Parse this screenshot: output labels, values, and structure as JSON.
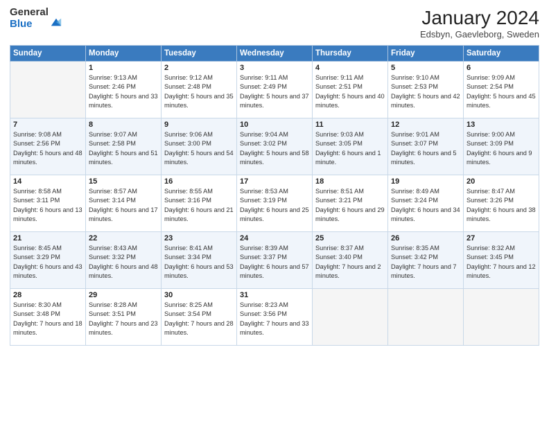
{
  "header": {
    "logo_general": "General",
    "logo_blue": "Blue",
    "month_title": "January 2024",
    "subtitle": "Edsbyn, Gaevleborg, Sweden"
  },
  "days_of_week": [
    "Sunday",
    "Monday",
    "Tuesday",
    "Wednesday",
    "Thursday",
    "Friday",
    "Saturday"
  ],
  "weeks": [
    [
      {
        "day": "",
        "empty": true
      },
      {
        "day": "1",
        "sunrise": "9:13 AM",
        "sunset": "2:46 PM",
        "daylight": "5 hours and 33 minutes."
      },
      {
        "day": "2",
        "sunrise": "9:12 AM",
        "sunset": "2:48 PM",
        "daylight": "5 hours and 35 minutes."
      },
      {
        "day": "3",
        "sunrise": "9:11 AM",
        "sunset": "2:49 PM",
        "daylight": "5 hours and 37 minutes."
      },
      {
        "day": "4",
        "sunrise": "9:11 AM",
        "sunset": "2:51 PM",
        "daylight": "5 hours and 40 minutes."
      },
      {
        "day": "5",
        "sunrise": "9:10 AM",
        "sunset": "2:53 PM",
        "daylight": "5 hours and 42 minutes."
      },
      {
        "day": "6",
        "sunrise": "9:09 AM",
        "sunset": "2:54 PM",
        "daylight": "5 hours and 45 minutes."
      }
    ],
    [
      {
        "day": "7",
        "sunrise": "9:08 AM",
        "sunset": "2:56 PM",
        "daylight": "5 hours and 48 minutes."
      },
      {
        "day": "8",
        "sunrise": "9:07 AM",
        "sunset": "2:58 PM",
        "daylight": "5 hours and 51 minutes."
      },
      {
        "day": "9",
        "sunrise": "9:06 AM",
        "sunset": "3:00 PM",
        "daylight": "5 hours and 54 minutes."
      },
      {
        "day": "10",
        "sunrise": "9:04 AM",
        "sunset": "3:02 PM",
        "daylight": "5 hours and 58 minutes."
      },
      {
        "day": "11",
        "sunrise": "9:03 AM",
        "sunset": "3:05 PM",
        "daylight": "6 hours and 1 minute."
      },
      {
        "day": "12",
        "sunrise": "9:01 AM",
        "sunset": "3:07 PM",
        "daylight": "6 hours and 5 minutes."
      },
      {
        "day": "13",
        "sunrise": "9:00 AM",
        "sunset": "3:09 PM",
        "daylight": "6 hours and 9 minutes."
      }
    ],
    [
      {
        "day": "14",
        "sunrise": "8:58 AM",
        "sunset": "3:11 PM",
        "daylight": "6 hours and 13 minutes."
      },
      {
        "day": "15",
        "sunrise": "8:57 AM",
        "sunset": "3:14 PM",
        "daylight": "6 hours and 17 minutes."
      },
      {
        "day": "16",
        "sunrise": "8:55 AM",
        "sunset": "3:16 PM",
        "daylight": "6 hours and 21 minutes."
      },
      {
        "day": "17",
        "sunrise": "8:53 AM",
        "sunset": "3:19 PM",
        "daylight": "6 hours and 25 minutes."
      },
      {
        "day": "18",
        "sunrise": "8:51 AM",
        "sunset": "3:21 PM",
        "daylight": "6 hours and 29 minutes."
      },
      {
        "day": "19",
        "sunrise": "8:49 AM",
        "sunset": "3:24 PM",
        "daylight": "6 hours and 34 minutes."
      },
      {
        "day": "20",
        "sunrise": "8:47 AM",
        "sunset": "3:26 PM",
        "daylight": "6 hours and 38 minutes."
      }
    ],
    [
      {
        "day": "21",
        "sunrise": "8:45 AM",
        "sunset": "3:29 PM",
        "daylight": "6 hours and 43 minutes."
      },
      {
        "day": "22",
        "sunrise": "8:43 AM",
        "sunset": "3:32 PM",
        "daylight": "6 hours and 48 minutes."
      },
      {
        "day": "23",
        "sunrise": "8:41 AM",
        "sunset": "3:34 PM",
        "daylight": "6 hours and 53 minutes."
      },
      {
        "day": "24",
        "sunrise": "8:39 AM",
        "sunset": "3:37 PM",
        "daylight": "6 hours and 57 minutes."
      },
      {
        "day": "25",
        "sunrise": "8:37 AM",
        "sunset": "3:40 PM",
        "daylight": "7 hours and 2 minutes."
      },
      {
        "day": "26",
        "sunrise": "8:35 AM",
        "sunset": "3:42 PM",
        "daylight": "7 hours and 7 minutes."
      },
      {
        "day": "27",
        "sunrise": "8:32 AM",
        "sunset": "3:45 PM",
        "daylight": "7 hours and 12 minutes."
      }
    ],
    [
      {
        "day": "28",
        "sunrise": "8:30 AM",
        "sunset": "3:48 PM",
        "daylight": "7 hours and 18 minutes."
      },
      {
        "day": "29",
        "sunrise": "8:28 AM",
        "sunset": "3:51 PM",
        "daylight": "7 hours and 23 minutes."
      },
      {
        "day": "30",
        "sunrise": "8:25 AM",
        "sunset": "3:54 PM",
        "daylight": "7 hours and 28 minutes."
      },
      {
        "day": "31",
        "sunrise": "8:23 AM",
        "sunset": "3:56 PM",
        "daylight": "7 hours and 33 minutes."
      },
      {
        "day": "",
        "empty": true
      },
      {
        "day": "",
        "empty": true
      },
      {
        "day": "",
        "empty": true
      }
    ]
  ],
  "labels": {
    "sunrise": "Sunrise:",
    "sunset": "Sunset:",
    "daylight": "Daylight:"
  }
}
